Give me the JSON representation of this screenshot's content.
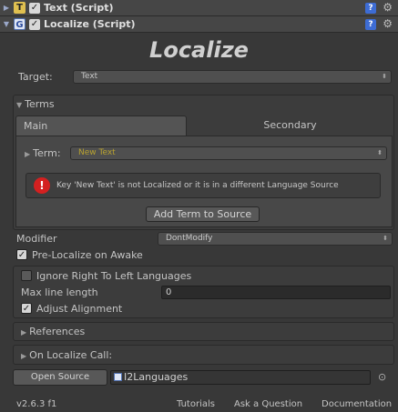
{
  "components": [
    {
      "icon_letter": "T",
      "title": "Text (Script)"
    },
    {
      "icon_letter": "G",
      "title": "Localize (Script)"
    }
  ],
  "header_icons": {
    "help": "?",
    "gear": "⚙"
  },
  "heading": "Localize",
  "target": {
    "label": "Target:",
    "value": "Text"
  },
  "terms": {
    "label": "Terms",
    "tabs": [
      {
        "label": "Main"
      },
      {
        "label": "Secondary"
      }
    ],
    "term_label": "Term:",
    "term_value": "New Text",
    "error_message": "Key 'New Text' is not Localized or it is in a different Language Source",
    "add_button": "Add Term to Source"
  },
  "modifier": {
    "label": "Modifier",
    "value": "DontModify"
  },
  "pre_localize": {
    "label": "Pre-Localize on Awake",
    "checked": true
  },
  "ignore_rtl": {
    "label": "Ignore Right To Left Languages",
    "checked": false
  },
  "max_line": {
    "label": "Max line length",
    "value": "0"
  },
  "adjust_alignment": {
    "label": "Adjust Alignment",
    "checked": true
  },
  "references_label": "References",
  "on_localize_label": "On Localize Call:",
  "open_source_button": "Open Source",
  "source_field_value": "I2Languages",
  "footer": {
    "version": "v2.6.3 f1",
    "tutorials": "Tutorials",
    "ask": "Ask a Question",
    "documentation": "Documentation"
  },
  "colors": {
    "term_value": "#b8a230",
    "error_red": "#d42020",
    "help_blue": "#3d6cd4",
    "text_icon_yellow": "#e0c050"
  }
}
